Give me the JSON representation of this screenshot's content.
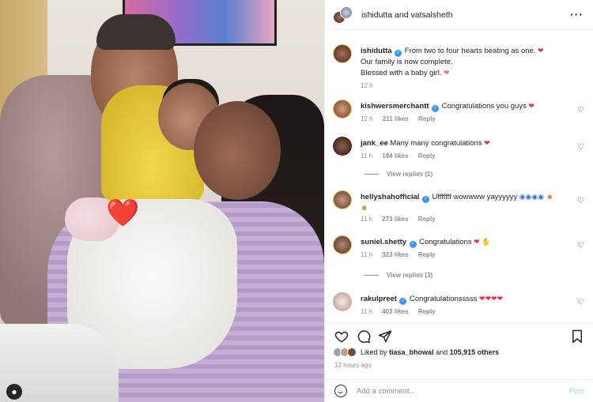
{
  "photo": {
    "sticker": "❤️"
  },
  "header": {
    "title": "ishidutta and vatsalsheth",
    "more_icon": "more-horizontal-icon"
  },
  "caption": {
    "username": "ishidutta",
    "lines": [
      "From two to four hearts beating as one.",
      "Our family is now complete.",
      "Blessed with a baby girl."
    ],
    "time": "12 h"
  },
  "comments": [
    {
      "username": "kishwersmerchantt",
      "verified": true,
      "text": "Congratulations you guys",
      "time": "12 h",
      "likes": "211 likes",
      "reply": "Reply"
    },
    {
      "username": "jank_ee",
      "verified": false,
      "text": "Many many congratulations",
      "time": "11 h",
      "likes": "194 likes",
      "reply": "Reply",
      "view_replies": "View replies (1)"
    },
    {
      "username": "hellyshahofficial",
      "verified": true,
      "text": "Ufffffff wowwww yayyyyyy",
      "time": "11 h",
      "likes": "273 likes",
      "reply": "Reply"
    },
    {
      "username": "suniel.shetty",
      "verified": true,
      "text": "Congratulations",
      "time": "11 h",
      "likes": "323 likes",
      "reply": "Reply",
      "view_replies": "View replies (3)"
    },
    {
      "username": "rakulpreet",
      "verified": true,
      "text": "Congratulationsssss",
      "time": "11 h",
      "likes": "403 likes",
      "reply": "Reply"
    }
  ],
  "liked_by": {
    "prefix": "Liked by",
    "user": "tiasa_bhowal",
    "and": "and",
    "count": "105,915 others"
  },
  "posted_ago": "12 hours ago",
  "add_comment": {
    "placeholder": "Add a comment...",
    "post_label": "Post"
  },
  "colors": {
    "accent": "#3897f0",
    "heart": "#e8324b",
    "muted": "#8e8e8e"
  }
}
